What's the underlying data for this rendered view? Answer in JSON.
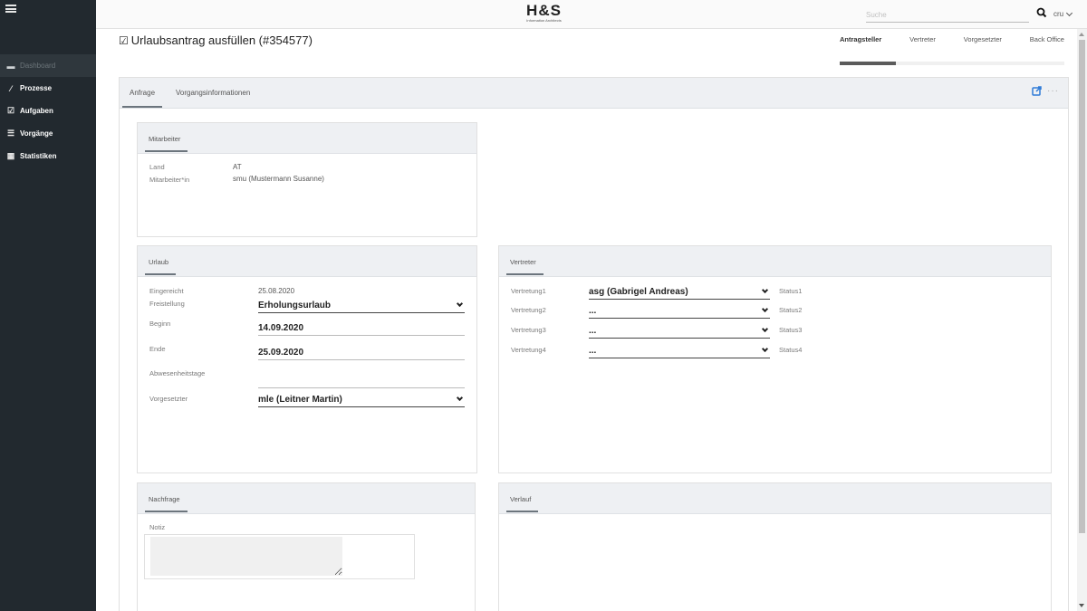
{
  "sidebar": {
    "items": [
      {
        "label": "Dashboard",
        "icon": "laptop-icon"
      },
      {
        "label": "Prozesse",
        "icon": "magic-wand-icon"
      },
      {
        "label": "Aufgaben",
        "icon": "check-square-icon"
      },
      {
        "label": "Vorgänge",
        "icon": "list-icon"
      },
      {
        "label": "Statistiken",
        "icon": "calendar-icon"
      }
    ]
  },
  "header": {
    "logo_main": "H&S",
    "logo_sub": "Information Architects",
    "search_placeholder": "Suche",
    "user": "cru"
  },
  "page": {
    "title": "Urlaubsantrag ausfüllen (#354577)"
  },
  "steps": {
    "labels": [
      "Antragsteller",
      "Vertreter",
      "Vorgesetzter",
      "Back Office"
    ],
    "active": "Antragsteller",
    "progress": 0.25
  },
  "tabs": [
    "Anfrage",
    "Vorgangsinformationen"
  ],
  "mitarbeiter": {
    "title": "Mitarbeiter",
    "land_label": "Land",
    "land_value": "AT",
    "ma_label": "Mitarbeiter*in",
    "ma_value": "smu (Mustermann Susanne)"
  },
  "urlaub": {
    "title": "Urlaub",
    "eingereicht_label": "Eingereicht",
    "eingereicht_value": "25.08.2020",
    "freistellung_label": "Freistellung",
    "freistellung_value": "Erholungsurlaub",
    "beginn_label": "Beginn",
    "beginn_value": "14.09.2020",
    "ende_label": "Ende",
    "ende_value": "25.09.2020",
    "abwesenheit_label": "Abwesenheitstage",
    "abwesenheit_value": "",
    "vorgesetzter_label": "Vorgesetzter",
    "vorgesetzter_value": "mle (Leitner Martin)"
  },
  "vertreter": {
    "title": "Vertreter",
    "rows": [
      {
        "label": "Vertretung1",
        "value": "asg (Gabrigel Andreas)",
        "status": "Status1"
      },
      {
        "label": "Vertretung2",
        "value": "...",
        "status": "Status2"
      },
      {
        "label": "Vertretung3",
        "value": "...",
        "status": "Status3"
      },
      {
        "label": "Vertretung4",
        "value": "...",
        "status": "Status4"
      }
    ]
  },
  "nachfrage": {
    "title": "Nachfrage",
    "notiz_label": "Notiz",
    "notiz_value": ""
  },
  "verlauf": {
    "title": "Verlauf"
  }
}
